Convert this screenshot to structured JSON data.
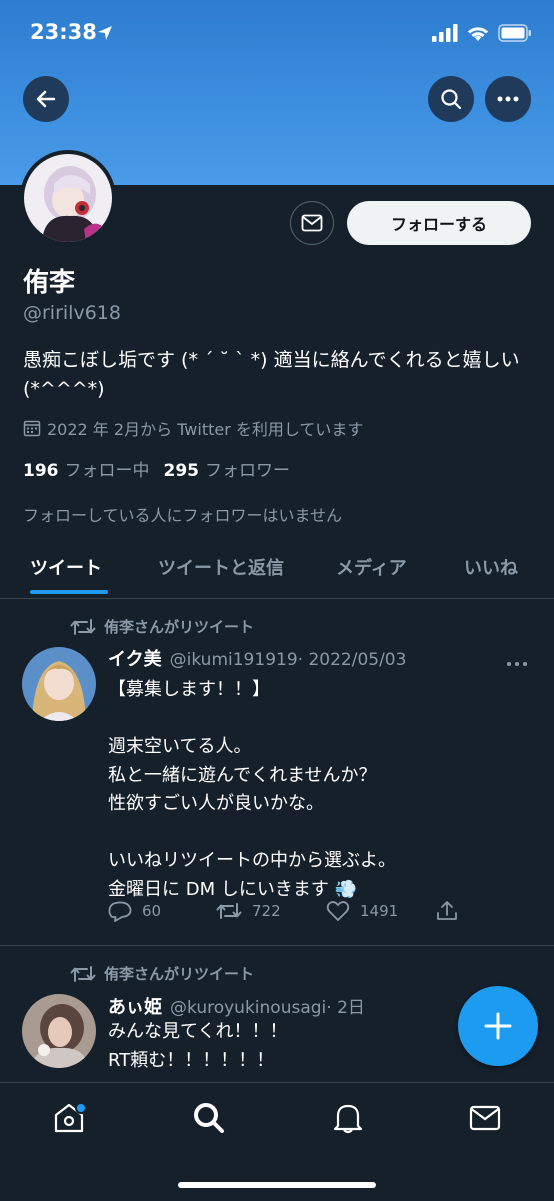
{
  "status_bar": {
    "time": "23:38"
  },
  "profile": {
    "name": "侑李",
    "handle": "@ririlv618",
    "bio": "愚痴こぼし垢です (* ´ ˘ ` *) 適当に絡んでくれると嬉しい (*^^^*)",
    "joined": "2022 年 2月から Twitter を利用しています",
    "following_count": "196",
    "following_label": "フォロー中",
    "followers_count": "295",
    "followers_label": "フォロワー",
    "no_mutual_followers": "フォローしている人にフォロワーはいません",
    "follow_button_label": "フォローする"
  },
  "tabs": [
    {
      "label": "ツイート",
      "active": true
    },
    {
      "label": "ツイートと返信"
    },
    {
      "label": "メディア"
    },
    {
      "label": "いいね"
    }
  ],
  "tweets": [
    {
      "retweet_label": "侑李さんがリツイート",
      "author_name": "イク美",
      "author_handle": "@ikumi191919",
      "date": "· 2022/05/03",
      "text": "【募集します！！】\n\n週末空いてる人。\n私と一緒に遊んでくれませんか？\n性欲すごい人が良いかな。\n\nいいねリツイートの中から選ぶよ。\n金曜日に DM しにいきます 💨",
      "replies": "60",
      "retweets": "722",
      "likes": "1491"
    },
    {
      "retweet_label": "侑李さんがリツイート",
      "author_name": "あぃ姫",
      "author_handle": "@kuroyukinousagi",
      "date": "· 2日",
      "text": "みんな見てくれ！！！\nRT頼む！！！！！！"
    }
  ],
  "colors": {
    "background": "#15202b",
    "accent": "#1d9bf0",
    "secondary_text": "#8b98a5",
    "banner": "#3d8fe0"
  },
  "icons": [
    "back-arrow-icon",
    "search-icon",
    "more-icon",
    "mail-icon",
    "calendar-icon",
    "retweet-icon",
    "reply-icon",
    "like-icon",
    "share-icon",
    "compose-icon",
    "home-icon",
    "bell-icon"
  ]
}
